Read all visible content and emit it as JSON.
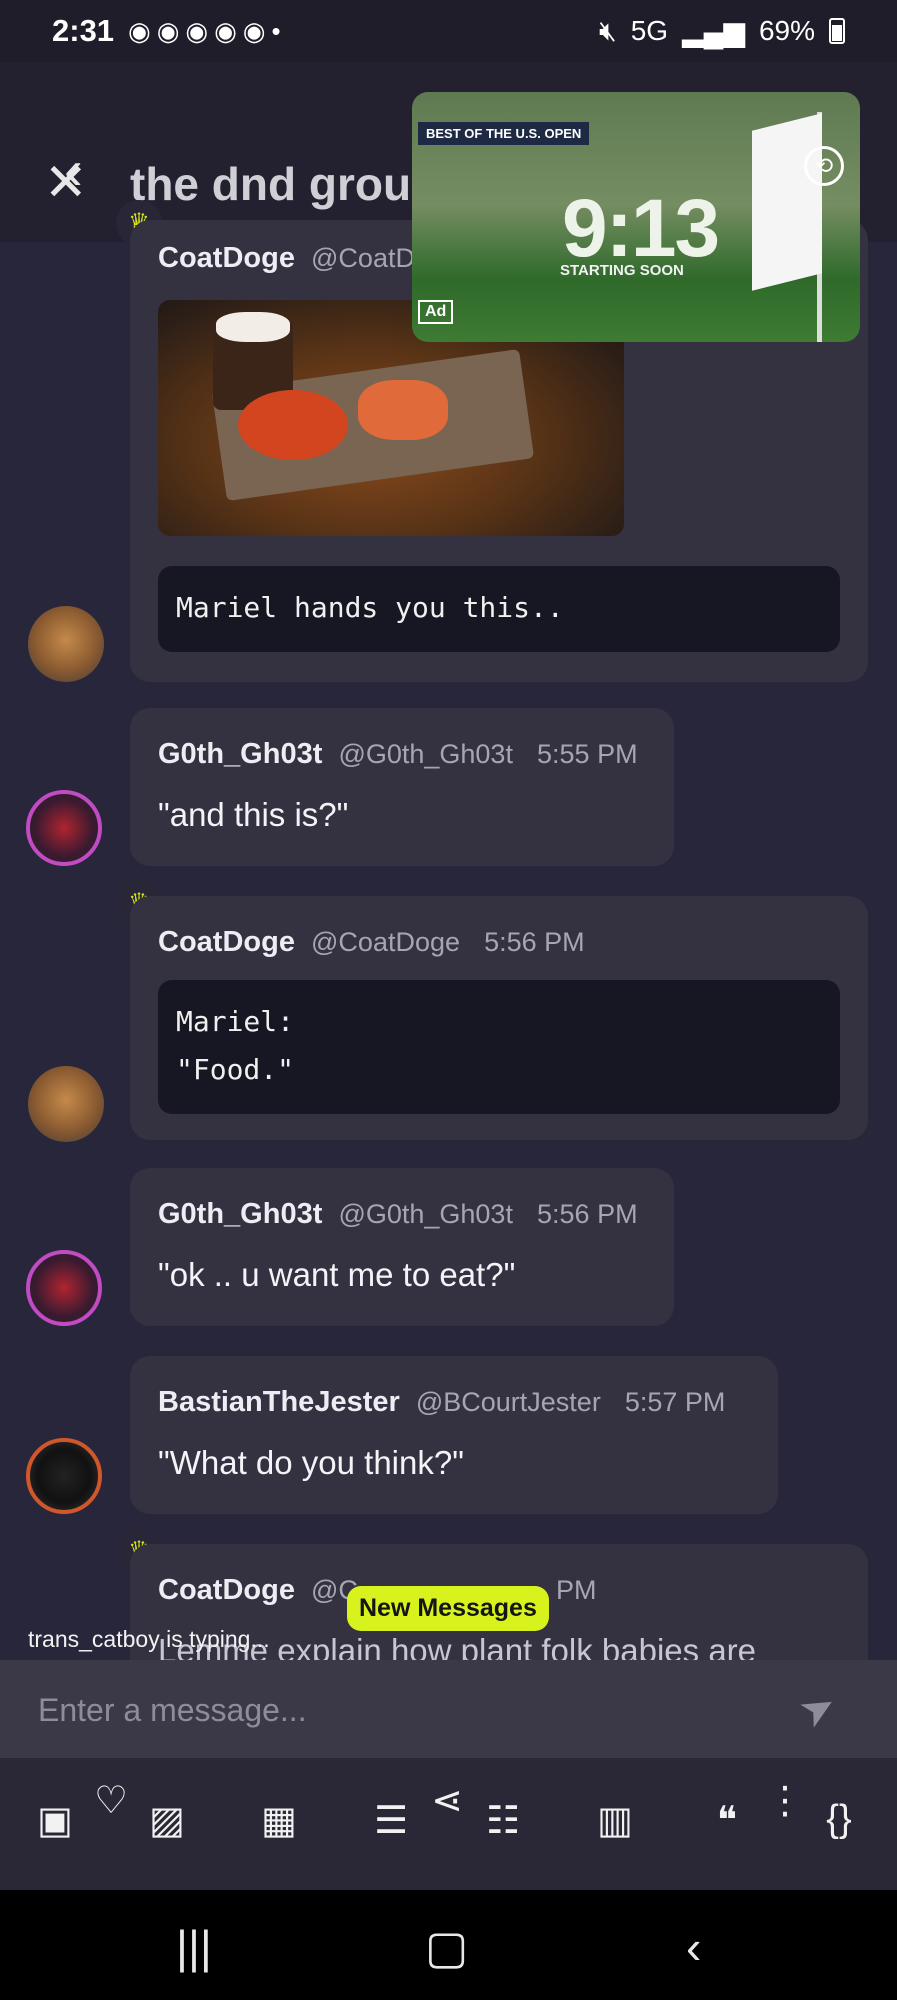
{
  "status_bar": {
    "time": "2:31",
    "right": "5G",
    "battery": "69%"
  },
  "header": {
    "title": "the dnd group"
  },
  "ad": {
    "badge": "BEST OF THE U.S. OPEN",
    "timer": "9:13",
    "subtitle": "STARTING SOON",
    "tag": "Ad"
  },
  "messages": [
    {
      "name": "CoatDoge",
      "handle": "@CoatD",
      "code": "Mariel hands you this.."
    },
    {
      "name": "G0th_Gh03t",
      "handle": "@G0th_Gh03t",
      "time": "5:55 PM",
      "text": "\"and this is?\""
    },
    {
      "name": "CoatDoge",
      "handle": "@CoatDoge",
      "time": "5:56 PM",
      "code": "Mariel:\n\"Food.\""
    },
    {
      "name": "G0th_Gh03t",
      "handle": "@G0th_Gh03t",
      "time": "5:56 PM",
      "text": "\"ok .. u want me to eat?\""
    },
    {
      "name": "BastianTheJester",
      "handle": "@BCourtJester",
      "time": "5:57 PM",
      "text": "\"What do you think?\""
    },
    {
      "name": "CoatDoge",
      "handle": "@C",
      "time": "PM",
      "text": "Lemme explain how plant folk babies are"
    }
  ],
  "new_messages_label": "New Messages",
  "typing_indicator": "trans_catboy is typing...",
  "input": {
    "placeholder": "Enter a message..."
  },
  "toolbar": {
    "icons": [
      "sticker-icon",
      "heart-icon",
      "image-icon",
      "gif-icon",
      "bullet-list-icon",
      "share-icon",
      "numbered-list-icon",
      "trash-icon",
      "quote-icon",
      "more-icon",
      "code-icon"
    ]
  }
}
